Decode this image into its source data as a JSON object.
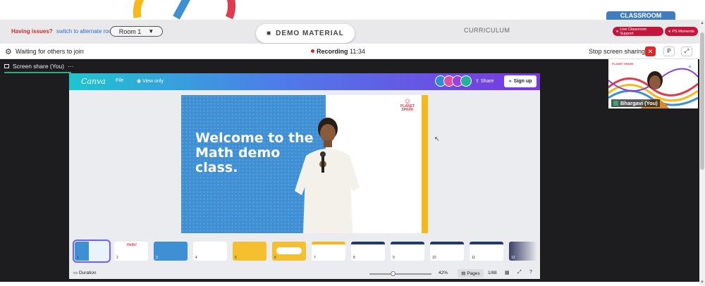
{
  "topbar": {
    "issues_text": "Having issues?",
    "alternate_link": "switch to alternate room",
    "room_select": "Room 1",
    "demo_material": "DEMO MATERIAL",
    "curriculum": "CURRICULUM",
    "classroom_tab": "CLASSROOM",
    "live_support": "Live Classroom Support",
    "ps_moments": "PS Moments"
  },
  "meeting": {
    "waiting": "Waiting for others to join",
    "recording_label": "Recording",
    "recording_time": "11:34",
    "stop_sharing": "Stop screen sharing",
    "p_button": "P"
  },
  "stage": {
    "share_tab": "Screen share (You)",
    "more": "···"
  },
  "canva": {
    "logo": "Canva",
    "file": "File",
    "view_only": "View only",
    "share": "Share",
    "sign_up": "Sign up",
    "slide_title": "Welcome to the Math demo class.",
    "brand": "PLANET SPARK",
    "duration": "Duration",
    "zoom": "42%",
    "pages": "Pages",
    "page_count": "1/88",
    "thumbnails": [
      "1",
      "2",
      "3",
      "4",
      "5",
      "6",
      "7",
      "8",
      "9",
      "10",
      "11",
      "12"
    ],
    "colors": {
      "canva_gradient_start": "#1fc5cf",
      "canva_gradient_end": "#7b35e0",
      "slide_blue": "#3e8fd3",
      "slide_yellow": "#f7b819"
    }
  },
  "participant": {
    "name": "Bhargavi (You)",
    "logo": "PLANET SPARK"
  },
  "colors": {
    "accent_red": "#d0272f",
    "classroom_blue": "#3f7dbf",
    "pill_red": "#c4163d",
    "stage_bg": "#1d1d1f"
  }
}
